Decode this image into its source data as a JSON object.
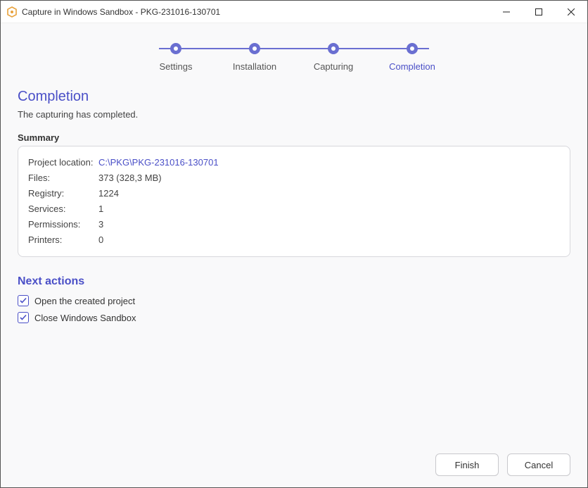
{
  "window": {
    "title": "Capture in Windows Sandbox - PKG-231016-130701"
  },
  "stepper": {
    "steps": [
      {
        "label": "Settings"
      },
      {
        "label": "Installation"
      },
      {
        "label": "Capturing"
      },
      {
        "label": "Completion"
      }
    ],
    "active_index": 3
  },
  "page": {
    "title": "Completion",
    "subtitle": "The capturing has completed."
  },
  "summary": {
    "heading": "Summary",
    "project_location_label": "Project location:",
    "project_location_value": "C:\\PKG\\PKG-231016-130701",
    "rows": [
      {
        "key": "Files:",
        "value": "373 (328,3 MB)"
      },
      {
        "key": "Registry:",
        "value": "1224"
      },
      {
        "key": "Services:",
        "value": "1"
      },
      {
        "key": "Permissions:",
        "value": "3"
      },
      {
        "key": "Printers:",
        "value": "0"
      }
    ]
  },
  "next_actions": {
    "heading": "Next actions",
    "items": [
      {
        "label": "Open the created project",
        "checked": true
      },
      {
        "label": "Close Windows Sandbox",
        "checked": true
      }
    ]
  },
  "footer": {
    "finish": "Finish",
    "cancel": "Cancel"
  }
}
